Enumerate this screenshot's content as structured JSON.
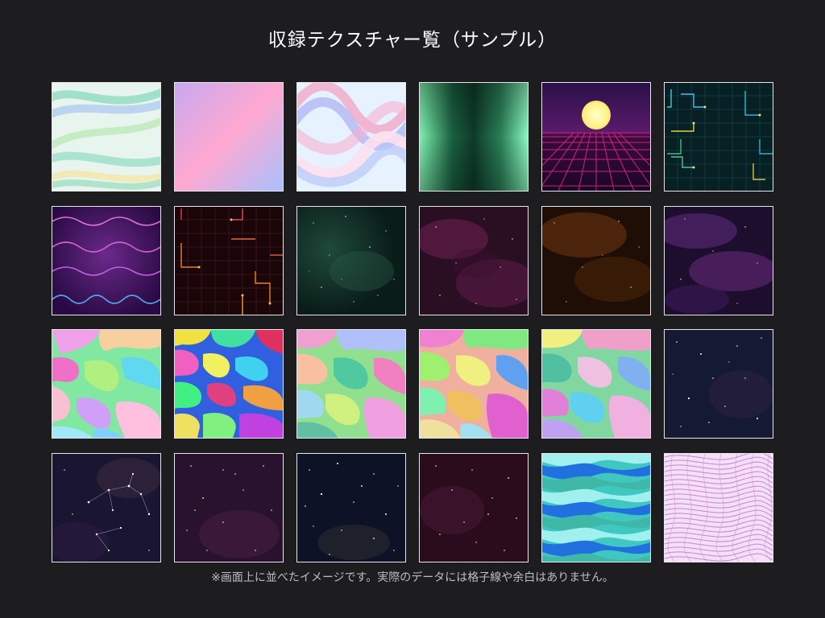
{
  "page": {
    "title": "収録テクスチャー覧（サンプル）",
    "note": "※画面上に並べたイメージです。実際のデータには格子線や余白はありません。"
  },
  "textures": [
    {
      "kind": "waves-pastel"
    },
    {
      "kind": "gradient-pastel"
    },
    {
      "kind": "ribbons"
    },
    {
      "kind": "green-glow"
    },
    {
      "kind": "synthwave-sun"
    },
    {
      "kind": "circuit-teal"
    },
    {
      "kind": "sine-lines"
    },
    {
      "kind": "circuit-red"
    },
    {
      "kind": "nebula-green"
    },
    {
      "kind": "nebula-magenta"
    },
    {
      "kind": "nebula-brown"
    },
    {
      "kind": "nebula-purple"
    },
    {
      "kind": "marble-1"
    },
    {
      "kind": "marble-2"
    },
    {
      "kind": "marble-3"
    },
    {
      "kind": "marble-4"
    },
    {
      "kind": "marble-5"
    },
    {
      "kind": "starfield-navy"
    },
    {
      "kind": "constellation"
    },
    {
      "kind": "starfield-plum"
    },
    {
      "kind": "starfield-deep"
    },
    {
      "kind": "starfield-wine"
    },
    {
      "kind": "stripes-aqua"
    },
    {
      "kind": "wavy-lines-pink"
    }
  ],
  "colors": {
    "background": "#1d1d20",
    "tile_border": "#e6e6ec",
    "title": "#ffffff",
    "note": "#bdbdc4"
  }
}
